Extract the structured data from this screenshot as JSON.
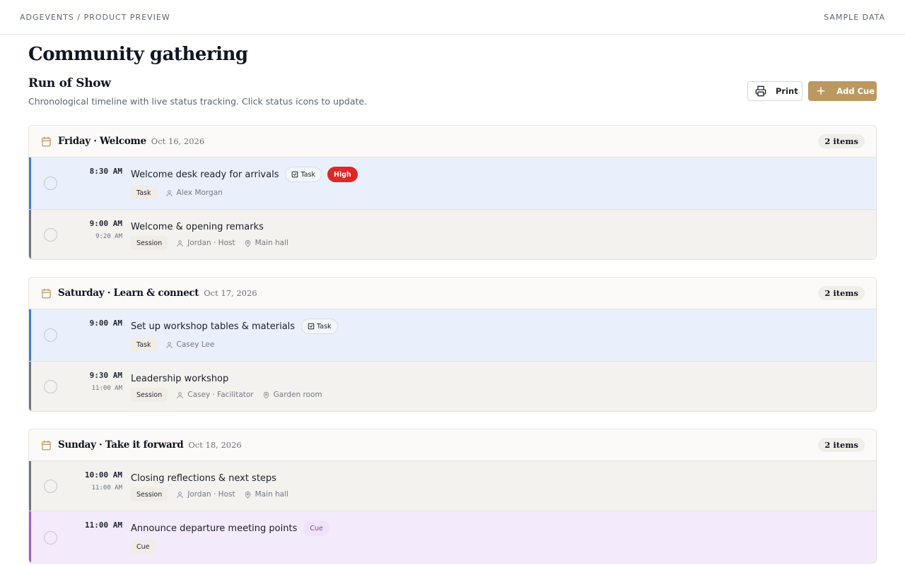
{
  "topbar": {
    "breadcrumb": "ADGEVENTS / PRODUCT PREVIEW",
    "sample_label": "SAMPLE DATA"
  },
  "page": {
    "title": "Community gathering",
    "section_title": "Run of Show",
    "section_subtitle": "Chronological timeline with live status tracking. Click status icons to update."
  },
  "toolbar": {
    "print_label": "Print",
    "add_label": "Add Cue"
  },
  "colors": {
    "accent": "#bb9860",
    "task": "#3b7fd4",
    "session": "#6e7585",
    "cue": "#a659d8",
    "high": "#dc2828"
  },
  "days": [
    {
      "name": "Friday · Welcome",
      "date": "Oct 16, 2026",
      "count": "2 items",
      "items": [
        {
          "kind": "task",
          "start": "8:30 AM",
          "end": "",
          "title": "Welcome desk ready for arrivals",
          "tag": "Task",
          "priority": "High",
          "type": "Task",
          "person": "Alex Morgan",
          "location": ""
        },
        {
          "kind": "session",
          "start": "9:00 AM",
          "end": "9:20 AM",
          "title": "Welcome & opening remarks",
          "tag": "",
          "priority": "",
          "type": "Session",
          "person": "Jordan · Host",
          "location": "Main hall"
        }
      ]
    },
    {
      "name": "Saturday · Learn & connect",
      "date": "Oct 17, 2026",
      "count": "2 items",
      "items": [
        {
          "kind": "task",
          "start": "9:00 AM",
          "end": "",
          "title": "Set up workshop tables & materials",
          "tag": "Task",
          "priority": "",
          "type": "Task",
          "person": "Casey Lee",
          "location": ""
        },
        {
          "kind": "session",
          "start": "9:30 AM",
          "end": "11:00 AM",
          "title": "Leadership workshop",
          "tag": "",
          "priority": "",
          "type": "Session",
          "person": "Casey · Facilitator",
          "location": "Garden room"
        }
      ]
    },
    {
      "name": "Sunday · Take it forward",
      "date": "Oct 18, 2026",
      "count": "2 items",
      "items": [
        {
          "kind": "session",
          "start": "10:00 AM",
          "end": "11:00 AM",
          "title": "Closing reflections & next steps",
          "tag": "",
          "priority": "",
          "type": "Session",
          "person": "Jordan · Host",
          "location": "Main hall"
        },
        {
          "kind": "cue",
          "start": "11:00 AM",
          "end": "",
          "title": "Announce departure meeting points",
          "tag": "Cue",
          "priority": "",
          "type": "Cue",
          "person": "",
          "location": ""
        }
      ]
    }
  ]
}
